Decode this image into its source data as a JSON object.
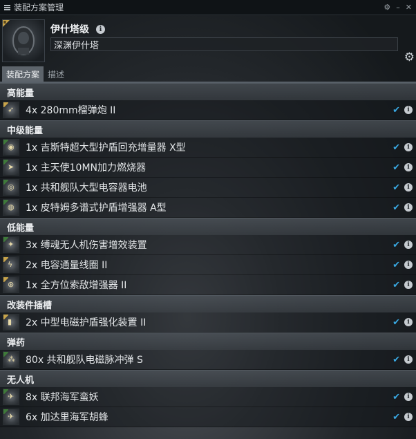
{
  "window": {
    "title": "装配方案管理"
  },
  "ship": {
    "name": "伊什塔级",
    "fit_name": "深渊伊什塔"
  },
  "tabs": [
    {
      "label": "装配方案",
      "active": true
    },
    {
      "label": "描述",
      "active": false
    }
  ],
  "sections": [
    {
      "name": "高能量",
      "items": [
        {
          "label": "4x 280mm榴弹炮 II",
          "icon": "projectile-turret-icon",
          "tech": "t2"
        }
      ]
    },
    {
      "name": "中级能量",
      "items": [
        {
          "label": "1x 吉斯特超大型护盾回充增量器 X型",
          "icon": "shield-booster-icon",
          "tech": "faction"
        },
        {
          "label": "1x 主天使10MN加力燃烧器",
          "icon": "afterburner-icon",
          "tech": "faction"
        },
        {
          "label": "1x 共和舰队大型电容器电池",
          "icon": "cap-battery-icon",
          "tech": "faction"
        },
        {
          "label": "1x 皮特姆多谱式护盾增强器 A型",
          "icon": "shield-extender-icon",
          "tech": "faction"
        }
      ]
    },
    {
      "name": "低能量",
      "items": [
        {
          "label": "3x 缚魂无人机伤害增效装置",
          "icon": "drone-damage-icon",
          "tech": "faction"
        },
        {
          "label": "2x 电容通量线圈 II",
          "icon": "flux-coil-icon",
          "tech": "t2"
        },
        {
          "label": "1x 全方位索敌增强器 II",
          "icon": "omnidirectional-tracking-icon",
          "tech": "t2"
        }
      ]
    },
    {
      "name": "改装件插槽",
      "items": [
        {
          "label": "2x 中型电磁护盾强化装置 II",
          "icon": "rig-icon",
          "tech": "t2"
        }
      ]
    },
    {
      "name": "弹药",
      "items": [
        {
          "label": "80x 共和舰队电磁脉冲弹 S",
          "icon": "ammo-icon",
          "tech": "faction"
        }
      ]
    },
    {
      "name": "无人机",
      "items": [
        {
          "label": "8x 联邦海军蛮妖",
          "icon": "drone-icon",
          "tech": "faction"
        },
        {
          "label": "6x 加达里海军胡蜂",
          "icon": "drone-icon",
          "tech": "faction"
        }
      ]
    }
  ],
  "colors": {
    "check": "#39a9e3",
    "tech2_badge": "#c8a44a",
    "faction_badge": "#3f7a3a",
    "faction_blue_badge": "#3e5f9e"
  }
}
